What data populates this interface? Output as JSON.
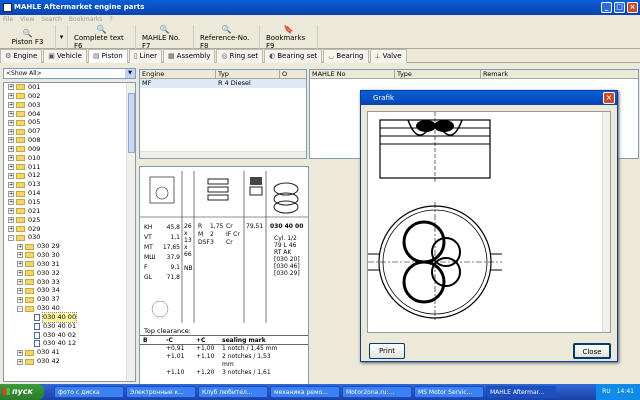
{
  "window": {
    "title": "MAHLE Aftermarket engine parts"
  },
  "menu": [
    "File",
    "View",
    "Search",
    "Bookmarks",
    "?"
  ],
  "toolbar": [
    {
      "label": "Piston  F3",
      "icon": "search-icon"
    },
    {
      "label": "Complete text  F6",
      "icon": "search-icon"
    },
    {
      "label": "MAHLE No.  F7",
      "icon": "search-icon"
    },
    {
      "label": "Reference-No.  F8",
      "icon": "search-icon"
    },
    {
      "label": "Bookmarks  F9",
      "icon": "bookmark-icon"
    }
  ],
  "tabs": [
    "Engine",
    "Vehicle",
    "Piston",
    "Liner",
    "Assembly",
    "Ring set",
    "Bearing set",
    "Bearing",
    "Valve"
  ],
  "combo": {
    "value": "<Show All>"
  },
  "tree": {
    "items": [
      {
        "label": "001",
        "depth": 0,
        "type": "folder",
        "exp": "+"
      },
      {
        "label": "002",
        "depth": 0,
        "type": "folder",
        "exp": "+"
      },
      {
        "label": "003",
        "depth": 0,
        "type": "folder",
        "exp": "+"
      },
      {
        "label": "004",
        "depth": 0,
        "type": "folder",
        "exp": "+"
      },
      {
        "label": "005",
        "depth": 0,
        "type": "folder",
        "exp": "+"
      },
      {
        "label": "007",
        "depth": 0,
        "type": "folder",
        "exp": "+"
      },
      {
        "label": "008",
        "depth": 0,
        "type": "folder",
        "exp": "+"
      },
      {
        "label": "009",
        "depth": 0,
        "type": "folder",
        "exp": "+"
      },
      {
        "label": "010",
        "depth": 0,
        "type": "folder",
        "exp": "+"
      },
      {
        "label": "011",
        "depth": 0,
        "type": "folder",
        "exp": "+"
      },
      {
        "label": "012",
        "depth": 0,
        "type": "folder",
        "exp": "+"
      },
      {
        "label": "013",
        "depth": 0,
        "type": "folder",
        "exp": "+"
      },
      {
        "label": "014",
        "depth": 0,
        "type": "folder",
        "exp": "+"
      },
      {
        "label": "015",
        "depth": 0,
        "type": "folder",
        "exp": "+"
      },
      {
        "label": "021",
        "depth": 0,
        "type": "folder",
        "exp": "+"
      },
      {
        "label": "025",
        "depth": 0,
        "type": "folder",
        "exp": "+"
      },
      {
        "label": "029",
        "depth": 0,
        "type": "folder",
        "exp": "+"
      },
      {
        "label": "030",
        "depth": 0,
        "type": "folder",
        "exp": "-"
      },
      {
        "label": "030 29",
        "depth": 1,
        "type": "folder",
        "exp": "+"
      },
      {
        "label": "030 30",
        "depth": 1,
        "type": "folder",
        "exp": "+"
      },
      {
        "label": "030 31",
        "depth": 1,
        "type": "folder",
        "exp": "+"
      },
      {
        "label": "030 32",
        "depth": 1,
        "type": "folder",
        "exp": "+"
      },
      {
        "label": "030 33",
        "depth": 1,
        "type": "folder",
        "exp": "+"
      },
      {
        "label": "030 34",
        "depth": 1,
        "type": "folder",
        "exp": "+"
      },
      {
        "label": "030 37",
        "depth": 1,
        "type": "folder",
        "exp": "+"
      },
      {
        "label": "030 40",
        "depth": 1,
        "type": "folder",
        "exp": "-"
      },
      {
        "label": "030 40 00",
        "depth": 2,
        "type": "doc",
        "exp": "",
        "selected": true
      },
      {
        "label": "030 40 01",
        "depth": 2,
        "type": "doc",
        "exp": ""
      },
      {
        "label": "030 40 02",
        "depth": 2,
        "type": "doc",
        "exp": ""
      },
      {
        "label": "030 40 12",
        "depth": 2,
        "type": "doc",
        "exp": ""
      },
      {
        "label": "030 41",
        "depth": 1,
        "type": "folder",
        "exp": "+"
      },
      {
        "label": "030 42",
        "depth": 1,
        "type": "folder",
        "exp": "+"
      }
    ]
  },
  "engine_grid": {
    "headers": [
      "Engine",
      "Typ",
      "O"
    ],
    "rows": [
      [
        "MF",
        "R 4 Diesel",
        ""
      ]
    ]
  },
  "parts_grid": {
    "headers": [
      "MAHLE No",
      "Type",
      "Remark"
    ]
  },
  "detail": {
    "left_specs": [
      [
        "KH",
        "45,8"
      ],
      [
        "VT",
        "1,1"
      ],
      [
        "MT",
        "17,65"
      ],
      [
        "МШ",
        "37,9"
      ],
      [
        "F",
        "9,1"
      ],
      [
        "GL",
        "71,8"
      ]
    ],
    "mid_col": [
      "26",
      "x",
      "13",
      "x",
      "66",
      "",
      "NB"
    ],
    "ring_specs": [
      [
        "R",
        "1,75",
        "Cr"
      ],
      [
        "M",
        "2",
        "IF Cr"
      ],
      [
        "DSF",
        "3",
        "Cr"
      ]
    ],
    "diameter": "79,51",
    "part_no": "030 40 00",
    "cyl_info": [
      "Cyl. 1/2",
      "79 L 46",
      "RT AK",
      "[030 20]",
      "[030 46]",
      "[030 29]"
    ],
    "top_clearance": "Top clearance:",
    "clear_headers": [
      "B",
      "-C",
      "+C",
      "sealing mark"
    ],
    "clear_rows": [
      [
        "",
        "+0,91",
        "+1,00",
        "1 notch / 1,45 mm"
      ],
      [
        "",
        "+1,01",
        "+1,10",
        "2 notches / 1,53"
      ],
      [
        "",
        "",
        "",
        "mm"
      ],
      [
        "",
        "+1,10",
        "+1,20",
        "3 notches / 1,61"
      ]
    ]
  },
  "dialog": {
    "title": "Grafik",
    "print": "Print",
    "close": "Close"
  },
  "taskbar": {
    "start": "пуск",
    "tasks": [
      "фото с диска",
      "Электронные к...",
      "Клуб любител...",
      "механика ремо...",
      "Motor2ona.ru:...",
      "MS Motor Servic...",
      "MAHLE Aftermar..."
    ],
    "lang": "RU",
    "clock": "14:41"
  },
  "colors": {
    "xp_blue": "#0842b0",
    "tree_folder": "#f4d56a",
    "close_red": "#d04a2a"
  }
}
